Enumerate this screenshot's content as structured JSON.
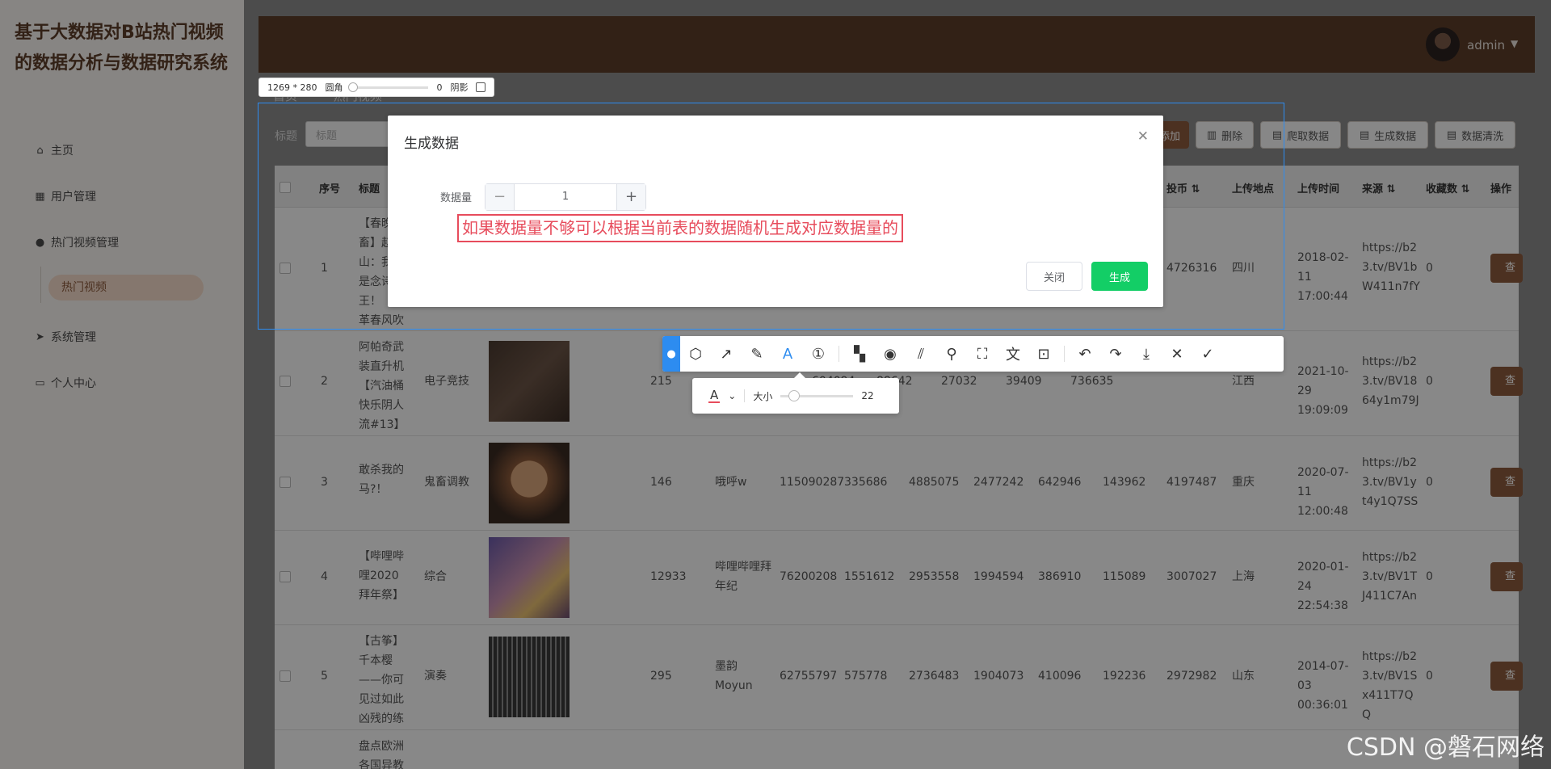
{
  "app": {
    "title": "基于大数据对B站热门视频的数据分析与数据研究系统"
  },
  "sidebar": {
    "items": [
      {
        "label": "主页",
        "icon": "home-icon"
      },
      {
        "label": "用户管理",
        "icon": "grid-icon"
      },
      {
        "label": "热门视频管理",
        "icon": "user-icon"
      },
      {
        "label": "系统管理",
        "icon": "send-icon"
      },
      {
        "label": "个人中心",
        "icon": "card-icon"
      }
    ],
    "submenu_active": "热门视频"
  },
  "header": {
    "username": "admin"
  },
  "breadcrumb": [
    "首页",
    "热门视频"
  ],
  "search": {
    "label": "标题",
    "placeholder": "标题"
  },
  "toolbar_buttons": {
    "add": "添加",
    "delete": "删除",
    "crawl": "爬取数据",
    "generate": "生成数据",
    "clean": "数据清洗"
  },
  "table": {
    "headers": {
      "index": "序号",
      "title": "标题",
      "coins": "投币",
      "location": "上传地点",
      "upload_time": "上传时间",
      "source": "来源",
      "favorites": "收藏数",
      "actions": "操作"
    },
    "view_label": "查看",
    "rows": [
      {
        "index": "1",
        "title": "【春晚鬼畜】赵本山：我就是念诗之王！【改革春风吹满地】",
        "coins": "4726316",
        "location": "四川",
        "upload_time": "2018-02-11 17:00:44",
        "source": "https://b23.tv/BV1bW411n7fY",
        "favorites": "0"
      },
      {
        "index": "2",
        "title": "阿帕奇武装直升机【汽油桶快乐阴人流#13】",
        "category": "电子竞技",
        "c1": "215",
        "c2": "604094",
        "c3": "88642",
        "c4": "27032",
        "c5": "39409",
        "coins": "736635",
        "location": "江西",
        "upload_time": "2021-10-29 19:09:09",
        "source": "https://b23.tv/BV1864y1m79J",
        "favorites": "0"
      },
      {
        "index": "3",
        "title": "敢杀我的马?！",
        "category": "鬼畜调教",
        "c1": "146",
        "author": "哦呼w",
        "c2": "115090287",
        "c3": "335686",
        "c4": "4885075",
        "c5": "2477242",
        "c6": "642946",
        "c7": "143962",
        "coins": "4197487",
        "location": "重庆",
        "upload_time": "2020-07-11 12:00:48",
        "source": "https://b23.tv/BV1yt4y1Q7SS",
        "favorites": "0"
      },
      {
        "index": "4",
        "title": "【哔哩哔哩2020拜年祭】",
        "category": "综合",
        "c1": "12933",
        "author": "哔哩哔哩拜年纪",
        "c2": "76200208",
        "c3": "1551612",
        "c4": "2953558",
        "c5": "1994594",
        "c6": "386910",
        "c7": "115089",
        "coins": "3007027",
        "location": "上海",
        "upload_time": "2020-01-24 22:54:38",
        "source": "https://b23.tv/BV1TJ411C7An",
        "favorites": "0"
      },
      {
        "index": "5",
        "title": "【古筝】千本樱——你可见过如此凶残的练习曲",
        "category": "演奏",
        "c1": "295",
        "author": "墨韵Moyun",
        "c2": "62755797",
        "c3": "575778",
        "c4": "2736483",
        "c5": "1904073",
        "c6": "410096",
        "c7": "192236",
        "coins": "2972982",
        "location": "山东",
        "upload_time": "2014-07-03 00:36:01",
        "source": "https://b23.tv/BV1Sx411T7QQ",
        "favorites": "0"
      },
      {
        "index": "",
        "title": "盘点欧洲各国异教符号,"
      }
    ]
  },
  "capture": {
    "dimensions": "1269 * 280",
    "radius_label": "圆角",
    "radius_value": "0",
    "shadow_label": "阴影"
  },
  "dialog": {
    "title": "生成数据",
    "quantity_label": "数据量",
    "quantity_value": "1",
    "annotation": "如果数据量不够可以根据当前表的数据随机生成对应数据量的",
    "close_label": "关闭",
    "generate_label": "生成"
  },
  "annotation_toolbar": {
    "size_label": "大小",
    "size_value": "22"
  },
  "watermark": "CSDN @磐石网络",
  "colors": {
    "brand": "#5c3d28",
    "accent": "#8b5a3c",
    "success": "#13ce66",
    "selection": "#2d8cf0",
    "annotation": "#e74c5c"
  }
}
